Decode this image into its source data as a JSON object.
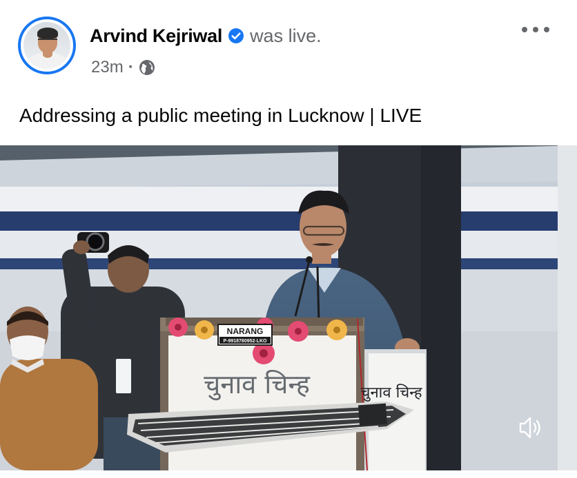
{
  "post": {
    "author_name": "Arvind Kejriwal",
    "status_text": "was live.",
    "timestamp": "23m",
    "separator": "·",
    "audience_icon": "globe-icon",
    "verified_icon": "verified-badge-icon",
    "text": "Addressing a public meeting in Lucknow | LIVE"
  },
  "menu": {
    "icon": "more-options-icon"
  },
  "video": {
    "sign_narang": "NARANG",
    "sign_phone": "P-9918780952-LKO",
    "podium_text": "चुनाव चिन्ह",
    "side_board_text": "चुनाव चिन्ह",
    "mute_icon": "speaker-muted-icon"
  },
  "colors": {
    "brand_blue": "#1877f2",
    "secondary_text": "#65676b",
    "primary_text": "#050505"
  }
}
